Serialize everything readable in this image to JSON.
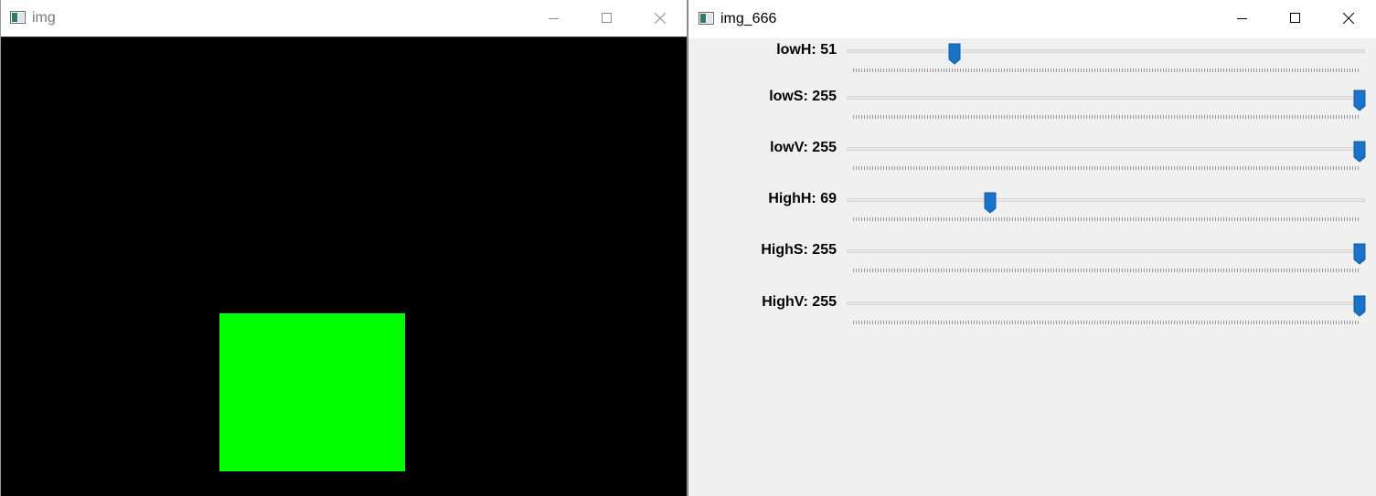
{
  "windows": {
    "image_window": {
      "title": "img",
      "icon": "opencv-window-icon",
      "buttons": [
        "minimize-icon",
        "maximize-icon",
        "close-icon"
      ]
    },
    "controls_window": {
      "title": "img_666",
      "icon": "opencv-window-icon",
      "buttons": [
        "minimize-icon",
        "maximize-icon",
        "close-icon"
      ]
    }
  },
  "image": {
    "background_color": "#000000",
    "shape_color": "#00ff00"
  },
  "trackbars": [
    {
      "label": "lowH: 51",
      "value": 51,
      "max": 255
    },
    {
      "label": "lowS: 255",
      "value": 255,
      "max": 255
    },
    {
      "label": "lowV: 255",
      "value": 255,
      "max": 255
    },
    {
      "label": "HighH: 69",
      "value": 69,
      "max": 255
    },
    {
      "label": "HighS: 255",
      "value": 255,
      "max": 255
    },
    {
      "label": "HighV: 255",
      "value": 255,
      "max": 255
    }
  ],
  "colors": {
    "thumb": "#1a73c8",
    "panel_bg": "#f0f0f0"
  }
}
